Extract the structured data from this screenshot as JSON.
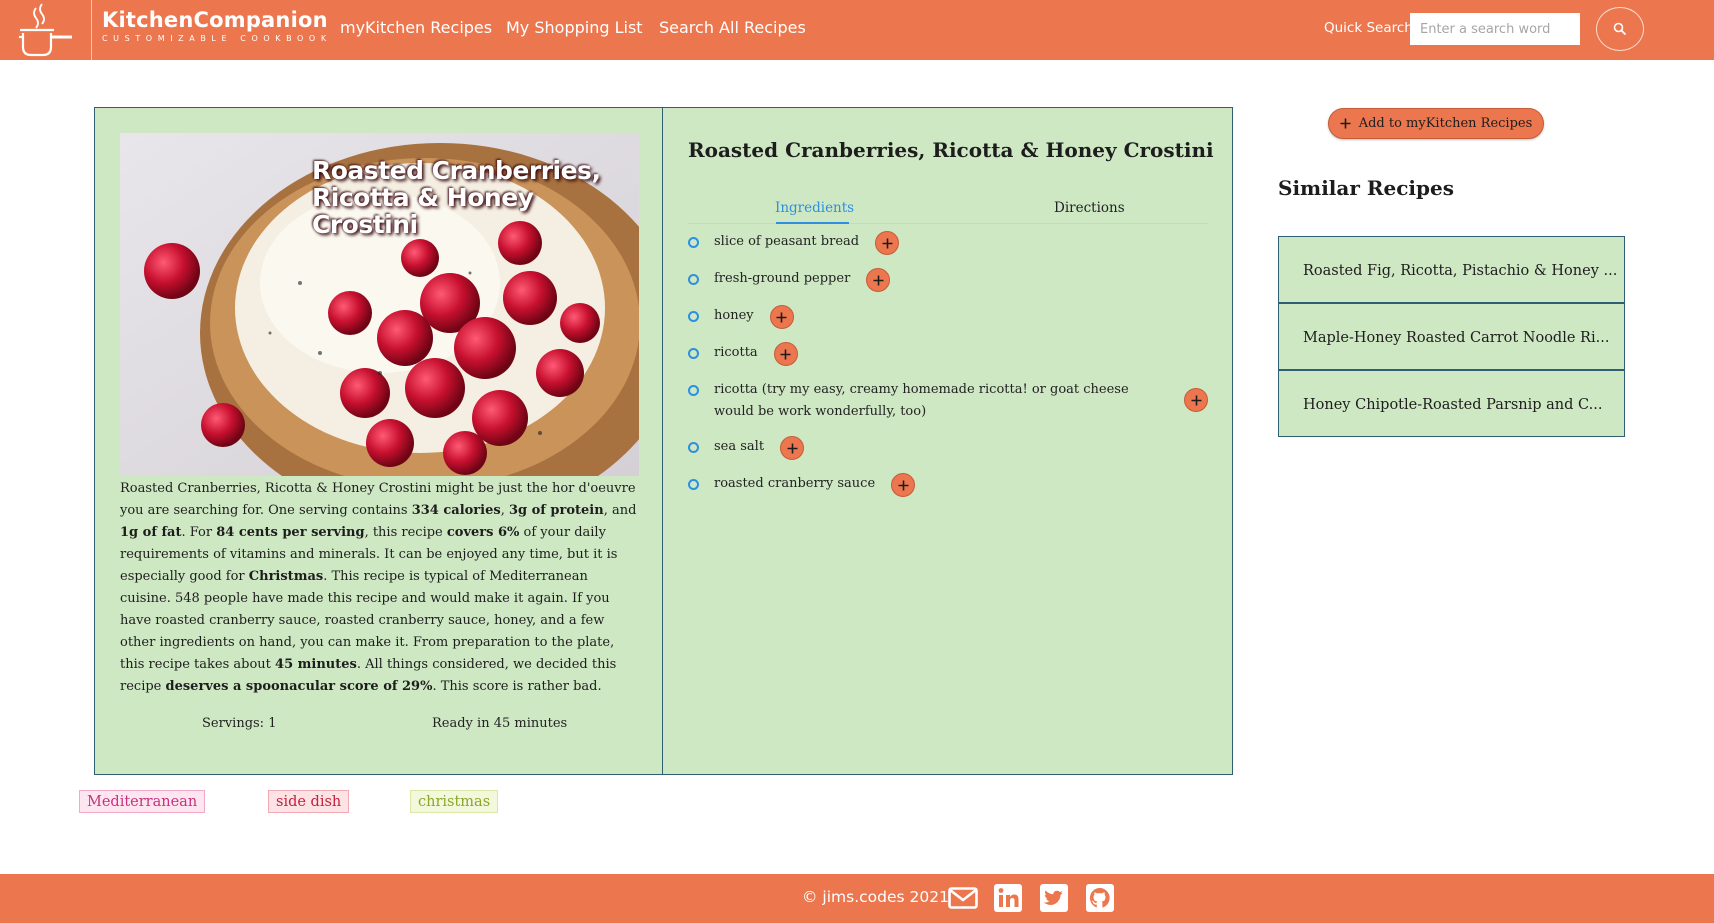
{
  "header": {
    "brand_name": "KitchenCompanion",
    "brand_tagline": "CUSTOMIZABLE COOKBOOK",
    "nav": [
      {
        "label": "myKitchen Recipes"
      },
      {
        "label": "My Shopping List"
      },
      {
        "label": "Search All Recipes"
      }
    ],
    "quick_search_label": "Quick Search",
    "search_placeholder": "Enter a search word"
  },
  "recipe": {
    "title": "Roasted Cranberries, Ricotta & Honey Crostini",
    "image_caption": "Roasted Cranberries, Ricotta & Honey Crostini",
    "summary": [
      {
        "t": "Roasted Cranberries, Ricotta & Honey Crostini might be just the hor d'oeuvre you are searching for. One serving contains "
      },
      {
        "t": "334 calories",
        "b": true
      },
      {
        "t": ", "
      },
      {
        "t": "3g of protein",
        "b": true
      },
      {
        "t": ", and "
      },
      {
        "t": "1g of fat",
        "b": true
      },
      {
        "t": ". For "
      },
      {
        "t": "84 cents per serving",
        "b": true
      },
      {
        "t": ", this recipe "
      },
      {
        "t": "covers 6%",
        "b": true
      },
      {
        "t": " of your daily requirements of vitamins and minerals. It can be enjoyed any time, but it is especially good for "
      },
      {
        "t": "Christmas",
        "b": true
      },
      {
        "t": ". This recipe is typical of Mediterranean cuisine. 548 people have made this recipe and would make it again. If you have roasted cranberry sauce, roasted cranberry sauce, honey, and a few other ingredients on hand, you can make it. From preparation to the plate, this recipe takes about "
      },
      {
        "t": "45 minutes",
        "b": true
      },
      {
        "t": ". All things considered, we decided this recipe "
      },
      {
        "t": "deserves a spoonacular score of 29%",
        "b": true
      },
      {
        "t": ". This score is rather bad."
      }
    ],
    "servings": "Servings: 1",
    "ready": "Ready in 45 minutes",
    "tabs": [
      {
        "label": "Ingredients",
        "active": true
      },
      {
        "label": "Directions",
        "active": false
      }
    ],
    "ingredients": [
      {
        "name": "slice of peasant bread"
      },
      {
        "name": "fresh-ground pepper"
      },
      {
        "name": "honey"
      },
      {
        "name": "ricotta"
      },
      {
        "name": "ricotta (try my easy, creamy homemade ricotta! or goat cheese would be work wonderfully, too)",
        "wide": true
      },
      {
        "name": "sea salt"
      },
      {
        "name": "roasted cranberry sauce"
      }
    ],
    "tags": [
      {
        "label": "Mediterranean"
      },
      {
        "label": "side dish"
      },
      {
        "label": "christmas"
      }
    ]
  },
  "sidebar": {
    "add_button_label": "Add to myKitchen Recipes",
    "similar_title": "Similar Recipes",
    "similar": [
      {
        "title": "Roasted Fig, Ricotta, Pistachio & Honey ..."
      },
      {
        "title": "Maple-Honey Roasted Carrot Noodle Ri..."
      },
      {
        "title": "Honey Chipotle-Roasted Parsnip and C..."
      }
    ]
  },
  "footer": {
    "copyright": "© jims.codes 2021",
    "icons": [
      "mail-icon",
      "linkedin-icon",
      "twitter-icon",
      "github-icon"
    ]
  },
  "colors": {
    "brand": "#ec764e",
    "card_green": "#cfe8c4",
    "card_border": "#2f5f72",
    "link_blue": "#2d8fe0"
  }
}
